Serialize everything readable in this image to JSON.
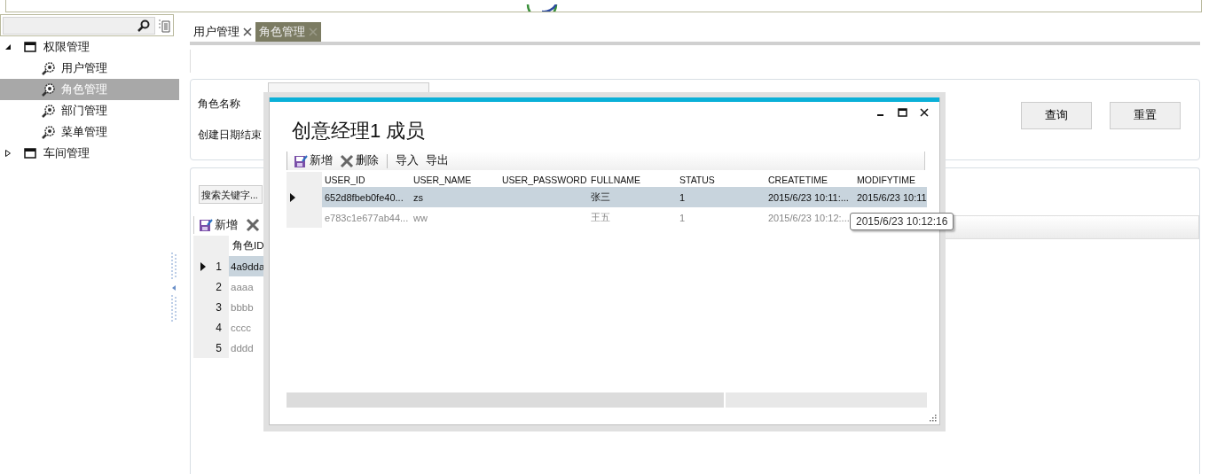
{
  "sidebar": {
    "tree": [
      {
        "label": "权限管理",
        "expanded": true,
        "children": [
          {
            "label": "用户管理",
            "selected": false
          },
          {
            "label": "角色管理",
            "selected": true
          },
          {
            "label": "部门管理",
            "selected": false
          },
          {
            "label": "菜单管理",
            "selected": false
          }
        ]
      },
      {
        "label": "车间管理",
        "expanded": false
      }
    ]
  },
  "tabs": [
    {
      "label": "用户管理",
      "selected": false
    },
    {
      "label": "角色管理",
      "selected": true
    }
  ],
  "query_form": {
    "fields": [
      {
        "label": "角色名称"
      },
      {
        "label": "创建日期结束"
      }
    ],
    "buttons": [
      "查询",
      "重置"
    ]
  },
  "role_list": {
    "search": {
      "placeholder": "搜索关键字..."
    },
    "toolbar": [
      {
        "kind": "add",
        "label": "新增"
      },
      {
        "kind": "delete"
      }
    ],
    "columns": [
      "角色ID"
    ],
    "rows": [
      {
        "number": "1",
        "role_id": "4a9dda",
        "selected": true
      },
      {
        "number": "2",
        "role_id": "aaaa",
        "selected": false
      },
      {
        "number": "3",
        "role_id": "bbbb",
        "selected": false
      },
      {
        "number": "4",
        "role_id": "cccc",
        "selected": false
      },
      {
        "number": "5",
        "role_id": "dddd",
        "selected": false
      }
    ]
  },
  "dialog": {
    "title": "创意经理1 成员",
    "toolbar": [
      {
        "kind": "add",
        "label": "新增"
      },
      {
        "kind": "delete",
        "label": "删除"
      },
      {
        "kind": "text",
        "label": "导入"
      },
      {
        "kind": "text",
        "label": "导出"
      }
    ],
    "columns": [
      "USER_ID",
      "USER_NAME",
      "USER_PASSWORD",
      "FULLNAME",
      "STATUS",
      "CREATETIME",
      "MODIFYTIME"
    ],
    "rows": [
      {
        "selected": true,
        "cells": [
          "652d8fbeb0fe40...",
          "zs",
          "",
          "张三",
          "1",
          "2015/6/23 10:11:...",
          "2015/6/23 10:11"
        ]
      },
      {
        "selected": false,
        "cells": [
          "e783c1e677ab44...",
          "ww",
          "",
          "王五",
          "1",
          "2015/6/23 10:12:...",
          ""
        ]
      }
    ],
    "tooltip": "2015/6/23 10:12:16"
  }
}
